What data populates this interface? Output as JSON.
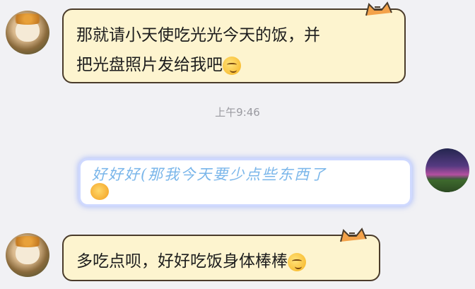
{
  "messages": [
    {
      "side": "left",
      "line1": "那就请小天使吃光光今天的饭，并",
      "line2": "把光盘照片发给我吧"
    },
    {
      "side": "right",
      "text": "好好好(那我今天要少点些东西了"
    },
    {
      "side": "left",
      "text": "多吃点呗，好好吃饭身体棒棒"
    }
  ],
  "timestamp": "上午9:46",
  "icons": {
    "bubble_emoji": "shy-smile-emoji",
    "bubble_deco": "cat-ear-decoration"
  },
  "colors": {
    "background": "#f1f1f4",
    "bubble_left": "#fdf4cf",
    "bubble_right_text": "#7ab6ea"
  }
}
